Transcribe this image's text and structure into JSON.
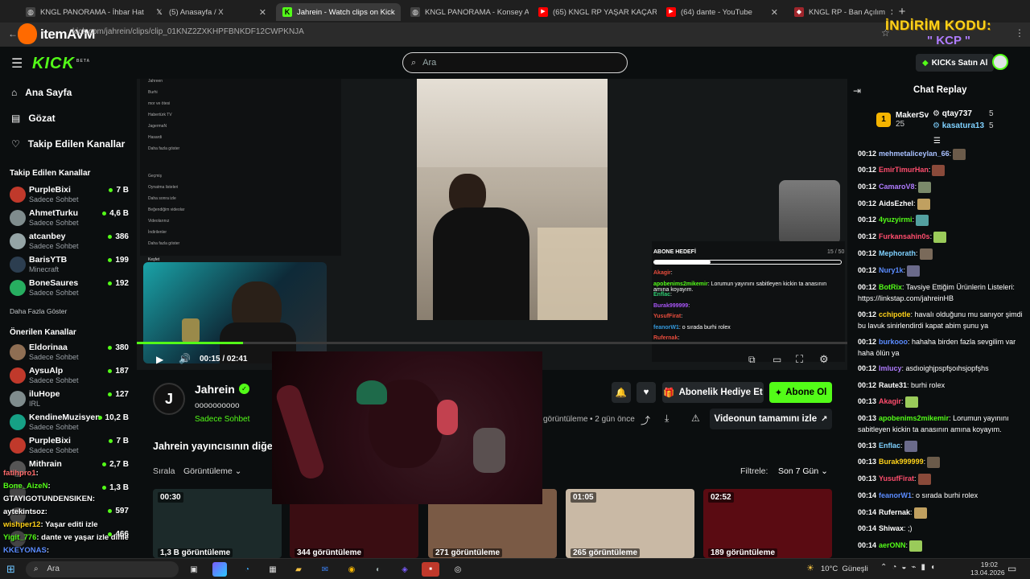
{
  "browser": {
    "tabs": [
      {
        "title": "KNGL PANORAMA - İhbar Hattı",
        "icon": "globe-icon"
      },
      {
        "title": "(5) Anasayfa / X",
        "icon": "x-icon"
      },
      {
        "title": "Jahrein - Watch clips on Kick",
        "icon": "kick-icon",
        "active": true
      },
      {
        "title": "KNGL PANORAMA - Konsey Ad",
        "icon": "globe-icon"
      },
      {
        "title": "(65) KNGL RP YAŞAR KAÇAR - Y",
        "icon": "youtube-icon"
      },
      {
        "title": "(64) dante - YouTube",
        "icon": "youtube-icon"
      },
      {
        "title": "KNGL RP - Ban Açılım",
        "icon": "shield-icon"
      }
    ],
    "url": "kick.com/jahrein/clips/clip_01KNZ2ZXKHPFBNKDF12CWPKNJA",
    "overlay_brand": "itemAVM",
    "promo_line1": "İNDİRİM KODU:",
    "promo_line2": "\" KCP \""
  },
  "header": {
    "logo": "KICK",
    "logo_badge": "BETA",
    "search_placeholder": "Ara",
    "buy_kicks_label": "KICKs Satın Al"
  },
  "sidebar": {
    "nav": [
      {
        "label": "Ana Sayfa",
        "icon": "home-icon"
      },
      {
        "label": "Gözat",
        "icon": "browse-icon"
      },
      {
        "label": "Takip Edilen Kanallar",
        "icon": "heart-icon"
      }
    ],
    "followed_heading": "Takip Edilen Kanallar",
    "followed": [
      {
        "name": "PurpleBixi",
        "category": "Sadece Sohbet",
        "viewers": "7 B",
        "color": "#c0392b"
      },
      {
        "name": "AhmetTurku",
        "category": "Sadece Sohbet",
        "viewers": "4,6 B",
        "color": "#7f8c8d"
      },
      {
        "name": "atcanbey",
        "category": "Sadece Sohbet",
        "viewers": "386",
        "color": "#95a5a6"
      },
      {
        "name": "BarisYTB",
        "category": "Minecraft",
        "viewers": "199",
        "color": "#2c3e50"
      },
      {
        "name": "BoneSaures",
        "category": "Sadece Sohbet",
        "viewers": "192",
        "color": "#27ae60"
      }
    ],
    "show_more": "Daha Fazla Göster",
    "recommended_heading": "Önerilen Kanallar",
    "recommended": [
      {
        "name": "Eldorinaa",
        "category": "Sadece Sohbet",
        "viewers": "380",
        "color": "#8e6e53"
      },
      {
        "name": "AysuAlp",
        "category": "Sadece Sohbet",
        "viewers": "187",
        "color": "#c0392b"
      },
      {
        "name": "iluHope",
        "category": "IRL",
        "viewers": "127",
        "color": "#7f8c8d"
      },
      {
        "name": "KendineMuzisyen",
        "category": "Sadece Sohbet",
        "viewers": "10,2 B",
        "color": "#16a085"
      },
      {
        "name": "PurpleBixi",
        "category": "Sadece Sohbet",
        "viewers": "7 B",
        "color": "#c0392b"
      },
      {
        "name": "Mithrain",
        "category": "...",
        "viewers": "2,7 B",
        "color": "#555"
      },
      {
        "name": "",
        "category": "",
        "viewers": "1,3 B",
        "color": "#444"
      },
      {
        "name": "",
        "category": "",
        "viewers": "597",
        "color": "#444"
      },
      {
        "name": "",
        "category": "",
        "viewers": "466",
        "color": "#444"
      }
    ]
  },
  "player": {
    "time_current": "00:15",
    "time_separator": "/",
    "time_total": "02:41",
    "progress": 0.15
  },
  "video_content": {
    "list_items": [
      "Jahreen",
      "Burhi",
      "mor ve ötesi",
      "Habertürk TV",
      "JagermaN",
      "Hasardi",
      "Daha fazla göster",
      "Geçmiş",
      "Oynatma listeleri",
      "Daha sonra izle",
      "Beğendiğim videolar",
      "Videolarınız",
      "İndirilenler",
      "Daha fazla göster"
    ],
    "section_label": "Keşfet",
    "abone_label": "ABONE HEDEFİ",
    "abone_count": "15 / 50",
    "stream_chat": [
      {
        "user": "Akagir",
        "color": "#e74c3c",
        "text": ":"
      },
      {
        "user": "apobenims2mikemir",
        "color": "#53fc18",
        "text": ": Lorumun yayınını sabitleyen kickin ta anasının amına koyayım."
      },
      {
        "user": "Enflac",
        "color": "#2ecc71",
        "text": ":"
      },
      {
        "user": "Burak999999",
        "color": "#a855f7",
        "text": ":"
      },
      {
        "user": "YusufFirat",
        "color": "#e74c3c",
        "text": ":"
      },
      {
        "user": "feanorW1",
        "color": "#3498db",
        "text": ": o sırada burhi rolex"
      },
      {
        "user": "Rufernak",
        "color": "#e74c3c",
        "text": ":"
      }
    ]
  },
  "channel": {
    "name": "Jahrein",
    "tagline": "oooooooooo",
    "category": "Sadece Sohbet",
    "gift_sub_label": "Abonelik Hediye Et",
    "subscribe_label": "Abone Ol",
    "views_meta": "görüntüleme",
    "time_ago": "2 gün önce",
    "full_video_label": "Videonun tamamını izle",
    "more_clips_heading": "Jahrein yayıncısının diğer",
    "sort_label": "Sırala",
    "sort_value": "Görüntüleme",
    "filter_label": "Filtrele:",
    "filter_value": "Son 7 Gün"
  },
  "clips": [
    {
      "duration": "00:30",
      "views": "1,3 B görüntüleme",
      "bg": "#1c2a2a"
    },
    {
      "duration": "",
      "views": "344 görüntüleme",
      "bg": "#3a0d12"
    },
    {
      "duration": "",
      "views": "271 görüntüleme",
      "bg": "#7a5a45"
    },
    {
      "duration": "01:05",
      "views": "265 görüntüleme",
      "bg": "#c9b9a5"
    },
    {
      "duration": "02:52",
      "views": "189 görüntüleme",
      "bg": "#5a0b12"
    }
  ],
  "overlay_chat": [
    {
      "user": "fatihpro1",
      "color": "#ff6b6b",
      "text": ":"
    },
    {
      "user": "Bone_AizeN",
      "color": "#53fc18",
      "text": ":"
    },
    {
      "user": "GTAYIGOTUNDENSIKEN",
      "color": "#ffffff",
      "text": ":"
    },
    {
      "user": "aytekintsoz",
      "color": "#ffffff",
      "text": ":"
    },
    {
      "user": "wishper12",
      "color": "#ffd21a",
      "text": ": Yaşar editi izle"
    },
    {
      "user": "Yigit_776",
      "color": "#53fc18",
      "text": ": dante ve yaşar izle dinle"
    },
    {
      "user": "KKEYONAS",
      "color": "#5b8cff",
      "text": ":"
    }
  ],
  "chat": {
    "title": "Chat Replay",
    "top_gifters": [
      {
        "name": "MakerSv",
        "count": "25"
      },
      {
        "name": "qtay737",
        "count": "5"
      },
      {
        "name": "kasatura13",
        "count": "5"
      }
    ],
    "messages": [
      {
        "time": "00:12",
        "user": "mehmetaliceylan_66",
        "color": "#a8c0ff",
        "text": ":"
      },
      {
        "time": "00:12",
        "user": "EmirTimurHan",
        "color": "#ff4d6d",
        "text": ":"
      },
      {
        "time": "00:12",
        "user": "CamaroV8",
        "color": "#b07cff",
        "text": ":"
      },
      {
        "time": "00:12",
        "user": "AidsEzhel",
        "color": "#ffffff",
        "text": ":"
      },
      {
        "time": "00:12",
        "user": "4yuzyirmi",
        "color": "#53fc18",
        "text": ":"
      },
      {
        "time": "00:12",
        "user": "Furkansahin0s",
        "color": "#ff4d6d",
        "text": ":"
      },
      {
        "time": "00:12",
        "user": "Mephorath",
        "color": "#7fd1ff",
        "text": ":"
      },
      {
        "time": "00:12",
        "user": "Nury1k",
        "color": "#5b8cff",
        "text": ":"
      },
      {
        "time": "00:12",
        "user": "BotRix",
        "color": "#53fc18",
        "text": ": Tavsiye Ettiğim Ürünlerin Listeleri: https://linkstap.com/jahreinHB"
      },
      {
        "time": "00:12",
        "user": "cchipotle",
        "color": "#ffd21a",
        "text": ": havalı olduğunu mu sanıyor şimdi bu lavuk sinirlendirdi kapat abim şunu ya"
      },
      {
        "time": "00:12",
        "user": "burkooo",
        "color": "#5b8cff",
        "text": ": hahaha birden fazla sevgilim var haha ölün ya"
      },
      {
        "time": "00:12",
        "user": "Imlucy",
        "color": "#b07cff",
        "text": ": asdıoighjpspfşoıhsjopfşhs"
      },
      {
        "time": "00:12",
        "user": "Raute31",
        "color": "#ffffff",
        "text": ": burhi rolex"
      },
      {
        "time": "00:13",
        "user": "Akagir",
        "color": "#ff4d6d",
        "text": ":"
      },
      {
        "time": "00:13",
        "user": "apobenims2mikemir",
        "color": "#53fc18",
        "text": ": Lorumun yayınını sabitleyen kickin ta anasının amına koyayım."
      },
      {
        "time": "00:13",
        "user": "Enflac",
        "color": "#7fd1ff",
        "text": ":"
      },
      {
        "time": "00:13",
        "user": "Burak999999",
        "color": "#ffd21a",
        "text": ":"
      },
      {
        "time": "00:13",
        "user": "YusufFirat",
        "color": "#ff4d6d",
        "text": ":"
      },
      {
        "time": "00:14",
        "user": "feanorW1",
        "color": "#5b8cff",
        "text": ": o sırada burhi rolex"
      },
      {
        "time": "00:14",
        "user": "Rufernak",
        "color": "#ffffff",
        "text": ":"
      },
      {
        "time": "00:14",
        "user": "Shiwax",
        "color": "#ffffff",
        "text": ": ;)"
      },
      {
        "time": "00:14",
        "user": "aerONN",
        "color": "#53fc18",
        "text": ":"
      }
    ]
  },
  "taskbar": {
    "search_placeholder": "Ara",
    "weather": "10°C",
    "weather_desc": "Güneşli",
    "time": "19:02",
    "date": "13.04.2026"
  }
}
